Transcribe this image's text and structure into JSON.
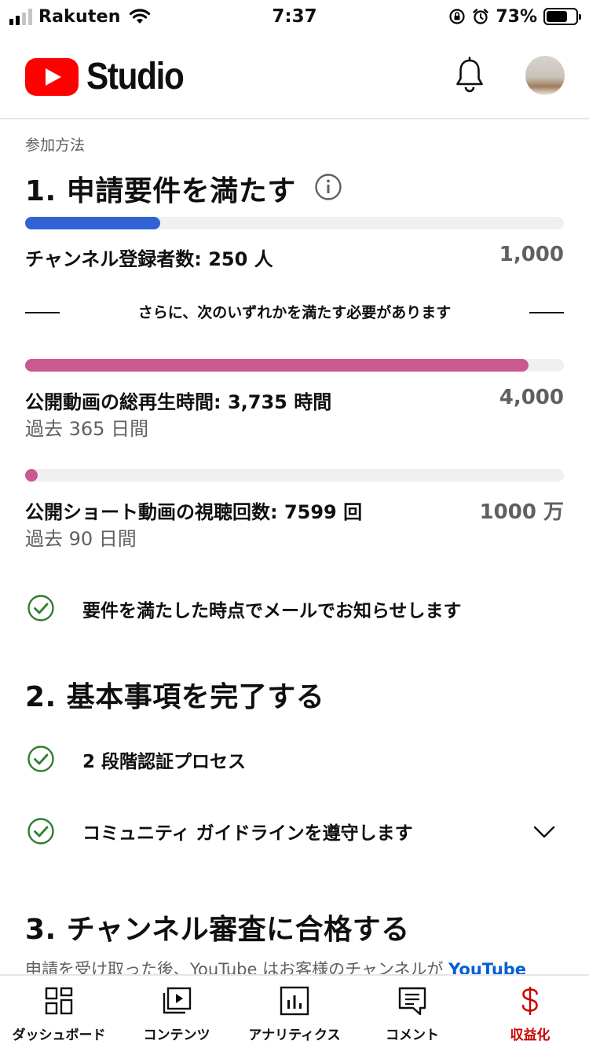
{
  "status_bar": {
    "carrier": "Rakuten",
    "time": "7:37",
    "battery_percent": "73%",
    "battery_level": 0.73
  },
  "header": {
    "logo_text": "Studio",
    "bell_icon": "bell-icon",
    "avatar": "avatar"
  },
  "main": {
    "overline": "参加方法",
    "step1": {
      "title": "1. 申請要件を満たす",
      "info_icon": "info-icon",
      "subscribers": {
        "label": "チャンネル登録者数: 250 人",
        "target": "1,000",
        "progress": 0.25,
        "color": "#3062d4"
      },
      "divider": "さらに、次のいずれかを満たす必要があります",
      "watch_hours": {
        "label": "公開動画の総再生時間: 3,735 時間",
        "target": "4,000",
        "sub": "過去 365 日間",
        "progress": 0.934,
        "color": "#c9598f"
      },
      "shorts_views": {
        "label": "公開ショート動画の視聴回数: 7599 回",
        "target": "1000 万",
        "sub": "過去 90 日間",
        "progress": 0.00076,
        "color": "#c9598f"
      },
      "email_notice": "要件を満たした時点でメールでお知らせします"
    },
    "step2": {
      "title": "2. 基本事項を完了する",
      "two_step": "2 段階認証プロセス",
      "guidelines": "コミュニティ ガイドラインを遵守します"
    },
    "step3": {
      "title": "3. チャンネル審査に合格する",
      "description": "申請を受け取った後、YouTube はお客様のチャンネルが",
      "link": "YouTube"
    }
  },
  "bottom_nav": {
    "items": [
      {
        "label": "ダッシュボード",
        "icon": "dashboard-icon"
      },
      {
        "label": "コンテンツ",
        "icon": "content-icon"
      },
      {
        "label": "アナリティクス",
        "icon": "analytics-icon"
      },
      {
        "label": "コメント",
        "icon": "comment-icon"
      },
      {
        "label": "収益化",
        "icon": "dollar-icon"
      }
    ],
    "active_color": "#cc0000"
  }
}
